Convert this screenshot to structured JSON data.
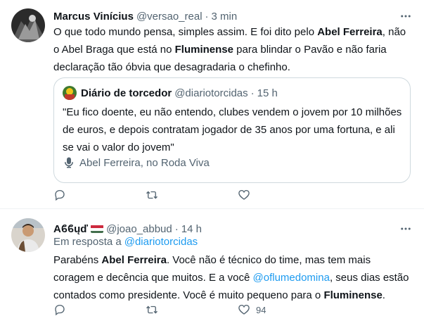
{
  "tweets": [
    {
      "name": "Marcus Vinícius",
      "handle": "@versao_real",
      "separator": "·",
      "time": "3 min",
      "text_parts": [
        "O que todo mundo pensa, simples assim. E foi dito pelo ",
        "Abel Ferreira",
        ", não o Abel Braga que está no ",
        "Fluminense",
        " para blindar o Pavão e não faria declaração tão óbvia que desagradaria o chefinho."
      ],
      "quote": {
        "name": "Diário de torcedor",
        "handle": "@diariotorcidas",
        "separator": "·",
        "time": "15 h",
        "text": "\"Eu fico doente, eu não entendo, clubes vendem o jovem por 10 milhões de euros, e depois contratam jogador de 35 anos por uma fortuna, e ali se vai o valor do jovem\"",
        "footer": "Abel Ferreira, no Roda Viva"
      },
      "actions": {
        "reply_count": "",
        "retweet_count": "",
        "like_count": ""
      }
    },
    {
      "name": "Aϐϐųď",
      "flag": "🇭🇺",
      "handle": "@joao_abbud",
      "separator": "·",
      "time": "14 h",
      "reply_to_label": "Em resposta a",
      "reply_to_handle": "@diariotorcidas",
      "text_parts": [
        "Parabéns ",
        "Abel Ferreira",
        ". Você não é técnico do time, mas tem mais coragem e decência que muitos. E a você ",
        "@oflumedomina",
        ", seus dias estão contados como presidente. Você é muito pequeno para o ",
        "Fluminense",
        "."
      ],
      "actions": {
        "reply_count": "",
        "retweet_count": "",
        "like_count": "94"
      }
    }
  ],
  "colors": {
    "accent": "#1d9bf0",
    "secondary_text": "#536471",
    "border": "#cfd9de",
    "flag_red": "#cd2a3e",
    "flag_green": "#436f4d"
  },
  "icons": [
    "more-icon",
    "microphone-icon",
    "reply-icon",
    "retweet-icon",
    "like-icon"
  ]
}
